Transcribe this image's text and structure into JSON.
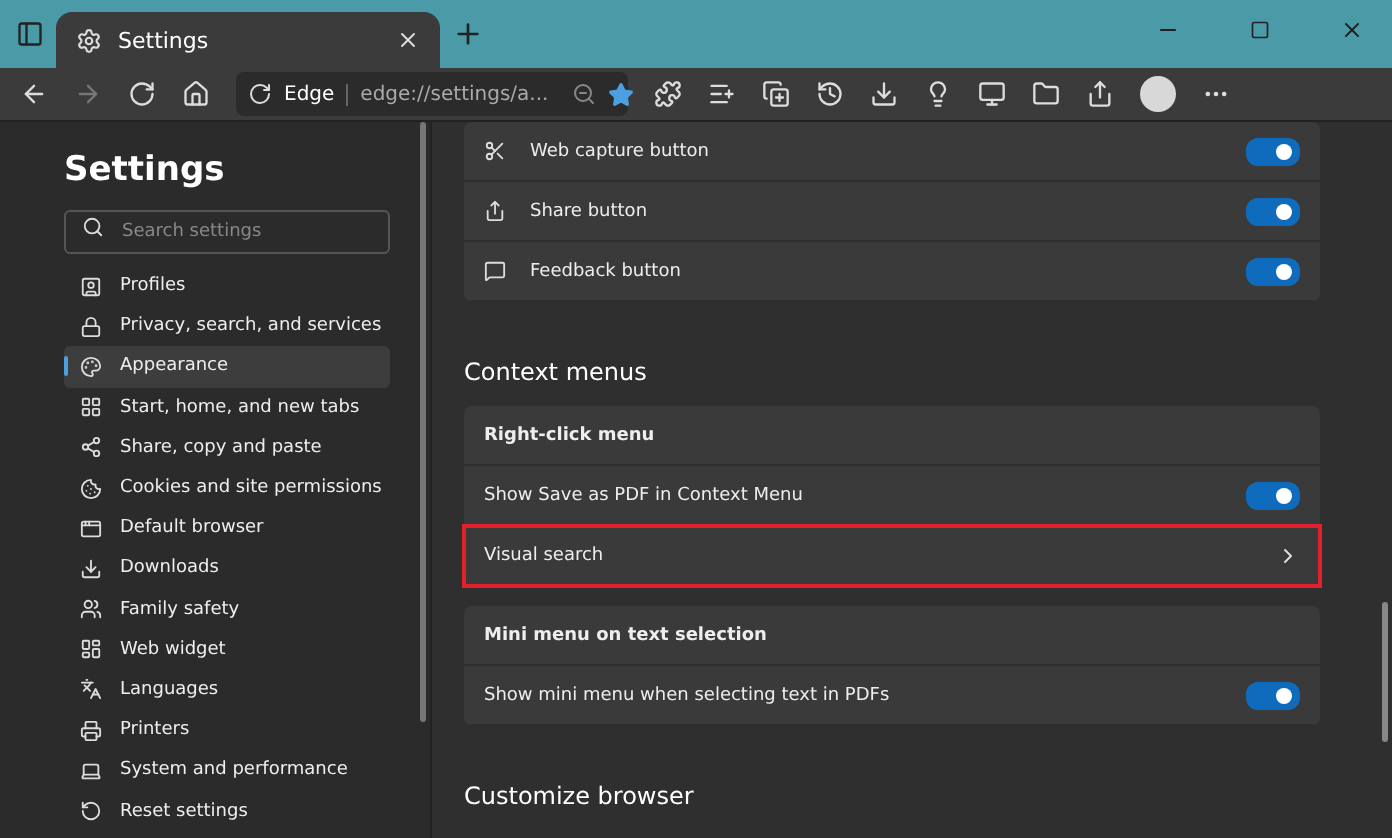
{
  "tab": {
    "title": "Settings"
  },
  "address": {
    "site": "Edge",
    "url": "edge://settings/a..."
  },
  "sidebar": {
    "title": "Settings",
    "search": {
      "placeholder": "Search settings"
    },
    "items": [
      {
        "label": "Profiles",
        "selected": false
      },
      {
        "label": "Privacy, search, and services",
        "selected": false
      },
      {
        "label": "Appearance",
        "selected": true
      },
      {
        "label": "Start, home, and new tabs",
        "selected": false
      },
      {
        "label": "Share, copy and paste",
        "selected": false
      },
      {
        "label": "Cookies and site permissions",
        "selected": false
      },
      {
        "label": "Default browser",
        "selected": false
      },
      {
        "label": "Downloads",
        "selected": false
      },
      {
        "label": "Family safety",
        "selected": false
      },
      {
        "label": "Web widget",
        "selected": false
      },
      {
        "label": "Languages",
        "selected": false
      },
      {
        "label": "Printers",
        "selected": false
      },
      {
        "label": "System and performance",
        "selected": false
      },
      {
        "label": "Reset settings",
        "selected": false
      }
    ]
  },
  "toolbar_card": [
    {
      "label": "Web capture button",
      "on": true
    },
    {
      "label": "Share button",
      "on": true
    },
    {
      "label": "Feedback button",
      "on": true
    }
  ],
  "sections": [
    {
      "title": "Context menus",
      "cards": [
        [
          {
            "kind": "header",
            "label": "Right-click menu"
          },
          {
            "kind": "toggle",
            "label": "Show Save as PDF in Context Menu",
            "on": true
          },
          {
            "kind": "link",
            "label": "Visual search",
            "highlighted": true
          }
        ],
        [
          {
            "kind": "header",
            "label": "Mini menu on text selection"
          },
          {
            "kind": "toggle",
            "label": "Show mini menu when selecting text in PDFs",
            "on": true
          }
        ]
      ]
    },
    {
      "title": "Customize browser"
    }
  ]
}
